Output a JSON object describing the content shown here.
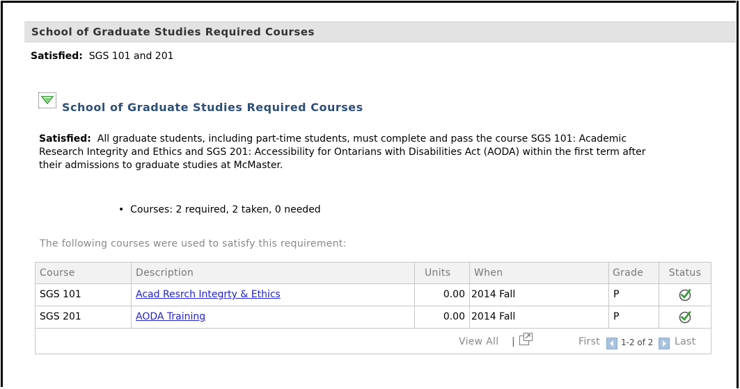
{
  "header": {
    "title": "School of Graduate Studies Required Courses"
  },
  "summary": {
    "label": "Satisfied:",
    "value": "SGS 101 and 201"
  },
  "group": {
    "title": "School of Graduate Studies Required Courses",
    "status_label": "Satisfied:",
    "description": "All graduate students, including part-time students, must complete and pass the course SGS 101: Academic Research Integrity and Ethics and SGS 201: Accessibility for Ontarians with Disabilities Act (AODA) within the first term after their admissions to graduate studies at McMaster.",
    "bullet": "Courses: 2 required, 2 taken, 0 needed"
  },
  "used_text": "The following courses were used to satisfy this requirement:",
  "table": {
    "columns": [
      "Course",
      "Description",
      "Units",
      "When",
      "Grade",
      "Status"
    ],
    "rows": [
      {
        "course": "SGS 101",
        "description": "Acad Resrch Integrty & Ethics",
        "units": "0.00",
        "when": "2014 Fall",
        "grade": "P",
        "status": "completed-check-icon"
      },
      {
        "course": "SGS 201",
        "description": "AODA Training",
        "units": "0.00",
        "when": "2014 Fall",
        "grade": "P",
        "status": "completed-check-icon"
      }
    ]
  },
  "footer": {
    "view_all": "View All",
    "separator": "|",
    "first": "First",
    "range": "1-2 of 2",
    "last": "Last"
  },
  "colors": {
    "link": "#1f1fc8",
    "group_title": "#2e4f7a",
    "check": "#3e9a3e"
  }
}
